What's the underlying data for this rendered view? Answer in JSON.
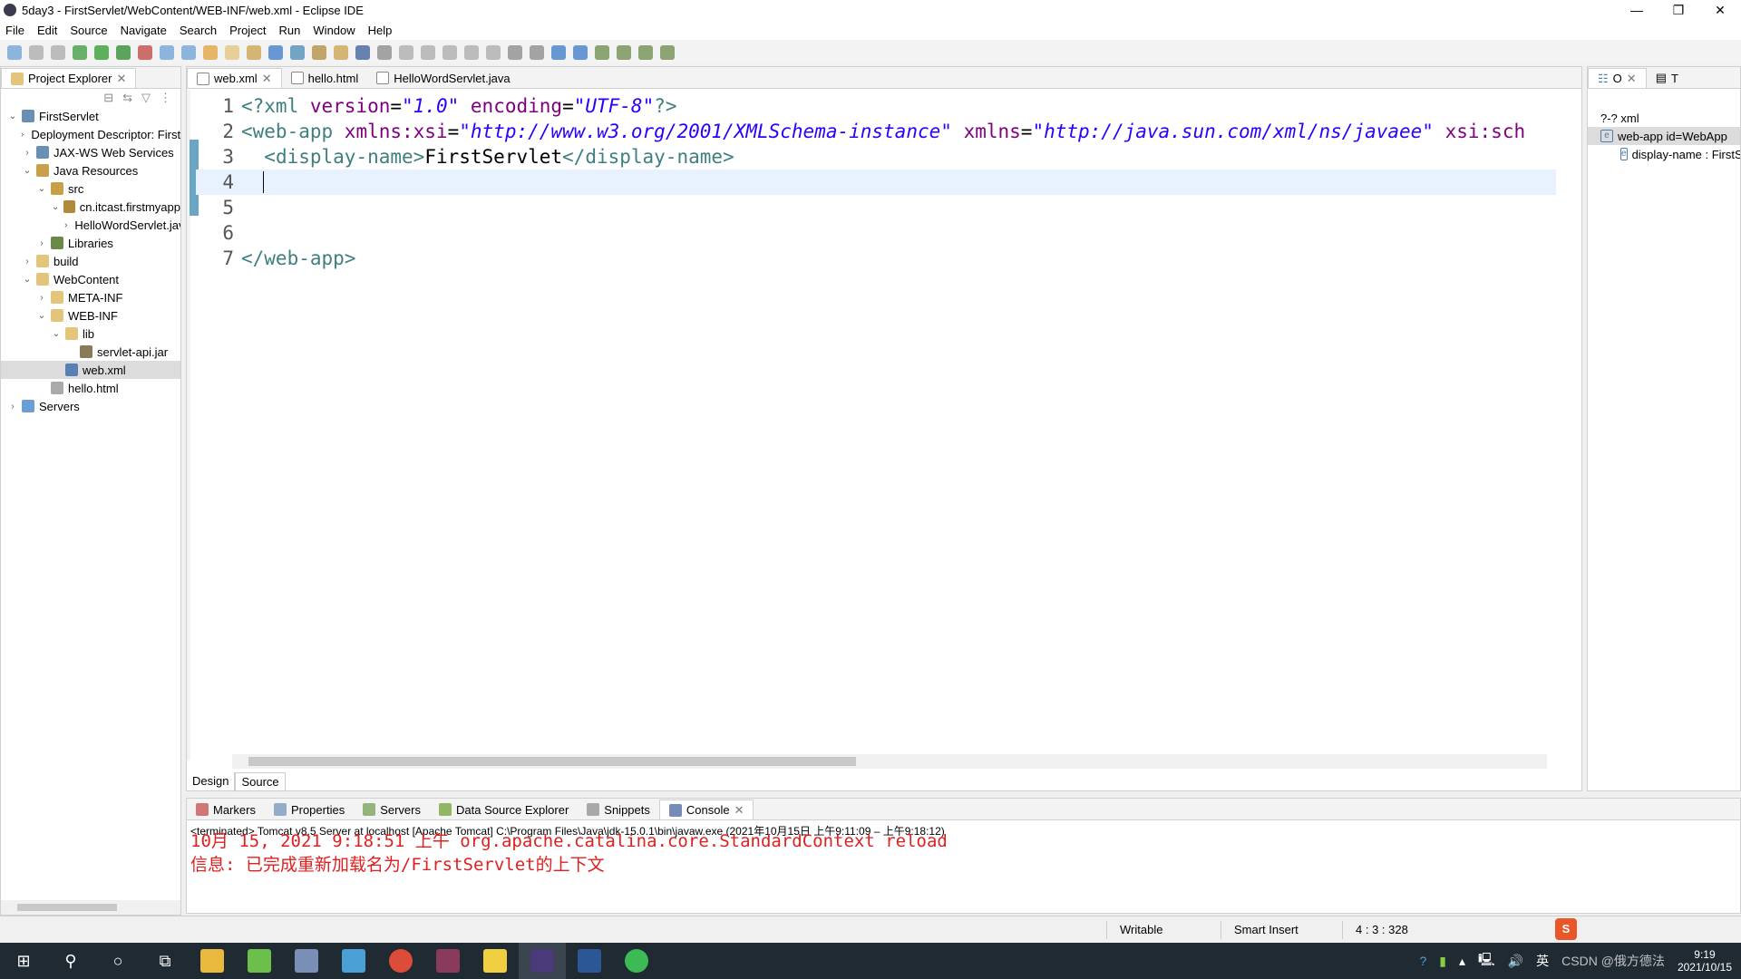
{
  "window": {
    "title": "5day3 - FirstServlet/WebContent/WEB-INF/web.xml - Eclipse IDE",
    "controls": [
      "—",
      "❐",
      "✕"
    ]
  },
  "menu": [
    "File",
    "Edit",
    "Source",
    "Navigate",
    "Search",
    "Project",
    "Run",
    "Window",
    "Help"
  ],
  "project_explorer": {
    "title": "Project Explorer",
    "items": [
      {
        "label": "FirstServlet",
        "depth": 0,
        "arrow": "v",
        "color": "#6a8fb5"
      },
      {
        "label": "Deployment Descriptor: FirstServlet",
        "depth": 1,
        "arrow": ">",
        "color": "#7a9a7a"
      },
      {
        "label": "JAX-WS Web Services",
        "depth": 1,
        "arrow": ">",
        "color": "#6a8fb5"
      },
      {
        "label": "Java Resources",
        "depth": 1,
        "arrow": "v",
        "color": "#c9a04a"
      },
      {
        "label": "src",
        "depth": 2,
        "arrow": "v",
        "color": "#c9a04a"
      },
      {
        "label": "cn.itcast.firstmyapp",
        "depth": 3,
        "arrow": "v",
        "color": "#b08a3a"
      },
      {
        "label": "HelloWordServlet.java",
        "depth": 4,
        "arrow": ">",
        "color": "#5a7fb5"
      },
      {
        "label": "Libraries",
        "depth": 2,
        "arrow": ">",
        "color": "#6a8a4a"
      },
      {
        "label": "build",
        "depth": 1,
        "arrow": ">",
        "color": "#e2c47a"
      },
      {
        "label": "WebContent",
        "depth": 1,
        "arrow": "v",
        "color": "#e2c47a"
      },
      {
        "label": "META-INF",
        "depth": 2,
        "arrow": ">",
        "color": "#e2c47a"
      },
      {
        "label": "WEB-INF",
        "depth": 2,
        "arrow": "v",
        "color": "#e2c47a"
      },
      {
        "label": "lib",
        "depth": 3,
        "arrow": "v",
        "color": "#e2c47a"
      },
      {
        "label": "servlet-api.jar",
        "depth": 4,
        "arrow": "",
        "color": "#8a7a5a"
      },
      {
        "label": "web.xml",
        "depth": 3,
        "arrow": "",
        "color": "#5a7fb5",
        "selected": true
      },
      {
        "label": "hello.html",
        "depth": 2,
        "arrow": "",
        "color": "#aaaaaa"
      },
      {
        "label": "Servers",
        "depth": 0,
        "arrow": ">",
        "color": "#6a9fd5"
      }
    ]
  },
  "editor": {
    "tabs": [
      {
        "label": "web.xml",
        "active": true,
        "closable": true
      },
      {
        "label": "hello.html"
      },
      {
        "label": "HelloWordServlet.java"
      }
    ],
    "lines": [
      {
        "n": "1",
        "parts": [
          [
            "tag",
            "<?xml "
          ],
          [
            "attr",
            "version"
          ],
          [
            "txt",
            "="
          ],
          [
            "str",
            "\"1.0\""
          ],
          [
            "txt",
            " "
          ],
          [
            "attr",
            "encoding"
          ],
          [
            "txt",
            "="
          ],
          [
            "str",
            "\"UTF-8\""
          ],
          [
            "tag",
            "?>"
          ]
        ]
      },
      {
        "n": "2",
        "parts": [
          [
            "tag",
            "<web-app "
          ],
          [
            "attr",
            "xmlns:xsi"
          ],
          [
            "txt",
            "="
          ],
          [
            "str",
            "\"http://www.w3.org/2001/XMLSchema-instance\""
          ],
          [
            "txt",
            " "
          ],
          [
            "attr",
            "xmlns"
          ],
          [
            "txt",
            "="
          ],
          [
            "str",
            "\"http://java.sun.com/xml/ns/javaee\""
          ],
          [
            "txt",
            " "
          ],
          [
            "attr",
            "xsi:sch"
          ]
        ]
      },
      {
        "n": "3",
        "parts": [
          [
            "txt",
            "  "
          ],
          [
            "tag",
            "<display-name>"
          ],
          [
            "txt",
            "FirstServlet"
          ],
          [
            "tag",
            "</display-name>"
          ]
        ]
      },
      {
        "n": "4",
        "parts": [],
        "current": true
      },
      {
        "n": "5",
        "parts": []
      },
      {
        "n": "6",
        "parts": []
      },
      {
        "n": "7",
        "parts": [
          [
            "tag",
            "</web-app>"
          ]
        ]
      }
    ],
    "bottom_tabs": [
      "Design",
      "Source"
    ]
  },
  "outline": {
    "tabs": [
      "O",
      "T"
    ],
    "items": [
      {
        "label": "?-? xml",
        "depth": 0
      },
      {
        "label": "web-app id=WebApp",
        "depth": 0,
        "selected": true
      },
      {
        "label": "display-name : FirstServlet",
        "depth": 1
      }
    ]
  },
  "bottom_panel": {
    "tabs": [
      "Markers",
      "Properties",
      "Servers",
      "Data Source Explorer",
      "Snippets",
      "Console"
    ],
    "console_header": "<terminated> Tomcat v8.5 Server at localhost [Apache Tomcat] C:\\Program Files\\Java\\jdk-15.0.1\\bin\\javaw.exe  (2021年10月15日 上午9:11:09 – 上午9:18:12)",
    "lines": [
      "10月 15, 2021 9:18:51 上午 org.apache.catalina.core.StandardContext reload",
      "信息: 已完成重新加载名为/FirstServlet的上下文"
    ],
    "color": "#e02020"
  },
  "status": {
    "writable": "Writable",
    "insert": "Smart Insert",
    "position": "4 : 3 : 328"
  },
  "taskbar": {
    "time": "9:19",
    "date": "2021/10/15",
    "ime": "英",
    "watermark": "CSDN @俄方德法"
  }
}
